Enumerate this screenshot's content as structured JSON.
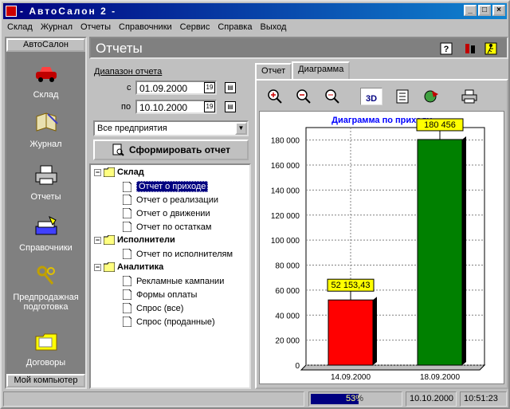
{
  "window": {
    "title": "- АвтоСалон 2 -"
  },
  "menu": [
    "Склад",
    "Журнал",
    "Отчеты",
    "Справочники",
    "Сервис",
    "Справка",
    "Выход"
  ],
  "sidebar": {
    "header": "АвтоСалон",
    "footer": "Мой компьютер",
    "items": [
      {
        "label": "Склад",
        "icon": "car-icon"
      },
      {
        "label": "Журнал",
        "icon": "journal-icon"
      },
      {
        "label": "Отчеты",
        "icon": "printer-icon"
      },
      {
        "label": "Справочники",
        "icon": "directory-icon"
      },
      {
        "label": "Предпродажная подготовка",
        "icon": "keys-icon"
      },
      {
        "label": "Договоры",
        "icon": "folder-icon"
      }
    ]
  },
  "page": {
    "title": "Отчеты"
  },
  "report_range": {
    "label": "Диапазон отчета",
    "from_label": "с",
    "from_value": "01.09.2000",
    "to_label": "по",
    "to_value": "10.10.2000"
  },
  "company_select": {
    "value": "Все предприятия"
  },
  "generate_button": "Сформировать отчет",
  "tree": {
    "groups": [
      {
        "label": "Склад",
        "items": [
          "Отчет о приходе",
          "Отчет о реализации",
          "Отчет о движении",
          "Отчет по остаткам"
        ]
      },
      {
        "label": "Исполнители",
        "items": [
          "Отчет по исполнителям"
        ]
      },
      {
        "label": "Аналитика",
        "items": [
          "Рекламные кампании",
          "Формы оплаты",
          "Спрос (все)",
          "Спрос (проданные)"
        ]
      }
    ],
    "selected": "Отчет о приходе"
  },
  "tabs": [
    {
      "label": "Отчет",
      "active": false
    },
    {
      "label": "Диаграмма",
      "active": true
    }
  ],
  "chart_toolbar": {
    "icons": [
      "zoom-in-icon",
      "zoom-out-icon",
      "zoom-reset-icon",
      "3d-toggle-icon",
      "data-table-icon",
      "export-icon",
      "print-icon"
    ],
    "3d_label": "3D"
  },
  "chart_data": {
    "type": "bar",
    "title": "Диаграмма по приходу",
    "categories": [
      "14.09.2000",
      "18.09.2000"
    ],
    "values": [
      52153.43,
      180456
    ],
    "value_labels": [
      "52 153,43",
      "180 456"
    ],
    "colors": [
      "#ff0000",
      "#008000"
    ],
    "title_color": "#0000ff",
    "ylim": [
      0,
      190000
    ],
    "yticks": [
      0,
      20000,
      40000,
      60000,
      80000,
      100000,
      120000,
      140000,
      160000,
      180000
    ],
    "ytick_labels": [
      "0",
      "20 000",
      "40 000",
      "60 000",
      "80 000",
      "100 000",
      "120 000",
      "140 000",
      "160 000",
      "180 000"
    ],
    "grid": true,
    "style": "3d"
  },
  "status": {
    "progress_text": "53%",
    "progress": 0.53,
    "date": "10.10.2000",
    "time": "10:51:23"
  }
}
